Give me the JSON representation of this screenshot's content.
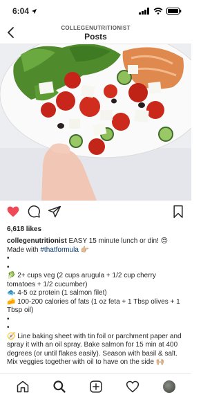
{
  "status_bar": {
    "time": "6:04"
  },
  "header": {
    "username": "COLLEGENUTRITIONIST",
    "title": "Posts"
  },
  "post": {
    "likes": "6,618 likes"
  },
  "caption": {
    "username": "collegenutritionist",
    "text_1": " EASY 15 minute lunch or din! 😍 Made with ",
    "hashtag": "#thatformula",
    "text_1_end": " 👉🏼",
    "bullet": "•",
    "veg": "🥬 2+ cups veg (2 cups arugula + 1/2 cup cherry tomatoes + 1/2 cucumber)",
    "protein": "🐟 4-5 oz protein (1 salmon filet)",
    "fats": "🧀 100-200 calories of fats (1 oz feta + 1 Tbsp olives + 1 Tbsp oil)",
    "instructions": "🧭 Line baking sheet with tin foil or parchment paper and spray it with an oil spray. Bake salmon for 15 min at 400 degrees (or until flakes easily). Season with basil & salt. Mix veggies together with oil to have on the side 🙌🏼"
  },
  "icons": {
    "back": "chevron-left-icon",
    "like": "heart-icon",
    "comment": "comment-icon",
    "share": "send-icon",
    "save": "bookmark-icon",
    "home": "home-icon",
    "search": "search-icon",
    "create": "plus-square-icon",
    "activity": "heart-outline-icon",
    "profile": "avatar"
  },
  "colors": {
    "like": "#ed4956",
    "hashtag": "#003569",
    "text": "#262626"
  }
}
